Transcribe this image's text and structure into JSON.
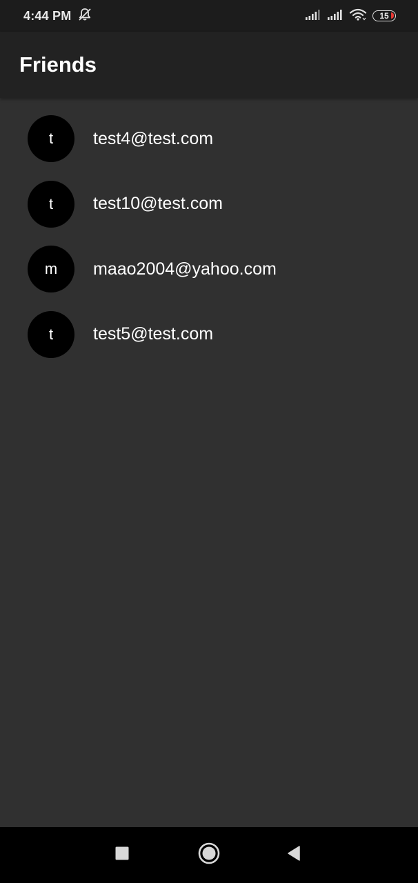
{
  "status_bar": {
    "time": "4:44 PM",
    "battery_level": "15",
    "icons": [
      "mute-notifications-icon",
      "signal-icon",
      "signal-icon",
      "wifi-icon",
      "battery-icon"
    ]
  },
  "app_bar": {
    "title": "Friends"
  },
  "friends": [
    {
      "initial": "t",
      "email": "test4@test.com"
    },
    {
      "initial": "t",
      "email": "test10@test.com"
    },
    {
      "initial": "m",
      "email": "maao2004@yahoo.com"
    },
    {
      "initial": "t",
      "email": "test5@test.com"
    }
  ],
  "nav_bar": {
    "buttons": [
      "recents-square-icon",
      "home-circle-icon",
      "back-triangle-icon"
    ]
  },
  "colors": {
    "background": "#303030",
    "app_bar": "#222222",
    "status_bar": "#1c1c1c",
    "avatar": "#000000",
    "text": "#ffffff",
    "battery_low": "#e53935"
  }
}
